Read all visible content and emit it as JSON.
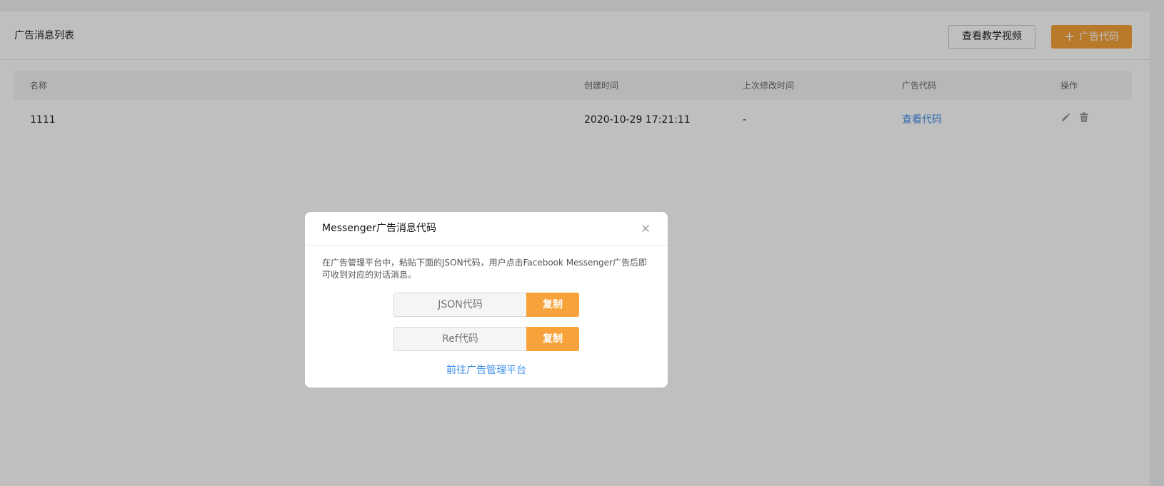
{
  "header": {
    "title": "广告消息列表",
    "video_button": "查看教学视频",
    "add_button": "广告代码",
    "add_icon": "plus-icon"
  },
  "table": {
    "columns": [
      "名称",
      "创建时间",
      "上次修改时间",
      "广告代码",
      "操作"
    ],
    "rows": [
      {
        "name": "1111",
        "created": "2020-10-29 17:21:11",
        "modified": "-",
        "code_link": "查看代码",
        "actions": [
          "edit-icon",
          "trash-icon"
        ]
      }
    ]
  },
  "modal": {
    "title": "Messenger广告消息代码",
    "description": "在广告管理平台中，粘贴下面的JSON代码，用户点击Facebook Messenger广告后即可收到对应的对话消息。",
    "json_placeholder": "JSON代码",
    "ref_placeholder": "Ref代码",
    "copy_label": "复制",
    "link_label": "前往广告管理平台",
    "close_icon": "close-icon"
  },
  "colors": {
    "accent": "#f7a23a",
    "link": "#3b8eea",
    "overlay": "rgba(0,0,0,0.25)"
  }
}
